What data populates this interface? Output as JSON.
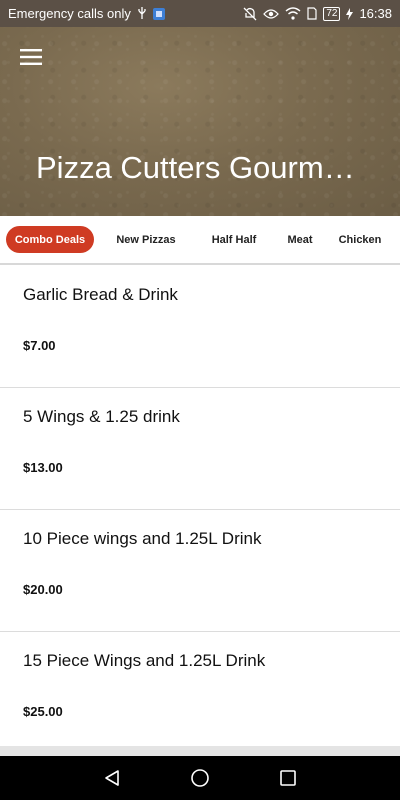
{
  "status_bar": {
    "carrier_text": "Emergency calls only",
    "battery_level": "72",
    "time": "16:38",
    "icons": [
      "usb-icon",
      "app-notification-icon",
      "mute-icon",
      "eye-icon",
      "wifi-icon",
      "sim-icon",
      "battery-icon",
      "charging-icon"
    ]
  },
  "header": {
    "title": "Pizza Cutters Gourm…",
    "menu_icon": "hamburger-menu-icon"
  },
  "tabs": [
    {
      "label": "Combo Deals",
      "active": true
    },
    {
      "label": "New Pizzas",
      "active": false
    },
    {
      "label": "Half Half",
      "active": false
    },
    {
      "label": "Meat",
      "active": false
    },
    {
      "label": "Chicken",
      "active": false
    }
  ],
  "items": [
    {
      "name": "Garlic Bread & Drink",
      "price": "$7.00"
    },
    {
      "name": "5 Wings & 1.25 drink",
      "price": "$13.00"
    },
    {
      "name": "10 Piece wings and 1.25L Drink",
      "price": "$20.00"
    },
    {
      "name": "15 Piece Wings and 1.25L Drink",
      "price": "$25.00"
    }
  ],
  "nav_bar": {
    "icons": [
      "back-icon",
      "home-icon",
      "recents-icon"
    ]
  },
  "colors": {
    "accent": "#cf3b23",
    "header_bg": "#7a6a4f",
    "nav_bg": "#000000"
  }
}
